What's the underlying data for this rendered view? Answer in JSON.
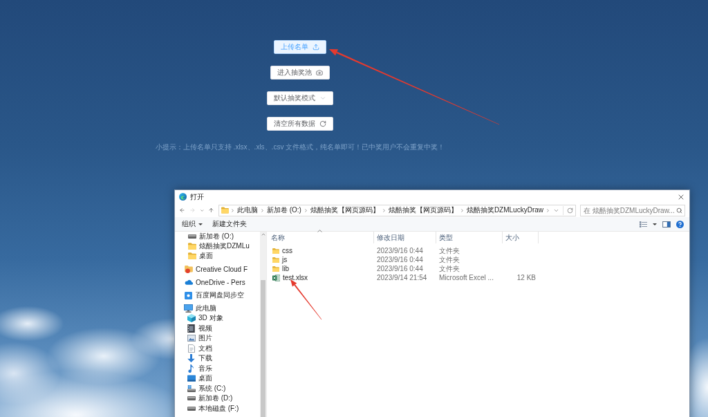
{
  "main": {
    "buttons": [
      {
        "kind": "upload",
        "label": "上传名单",
        "active": true
      },
      {
        "kind": "pool",
        "label": "进入抽奖池",
        "active": false
      },
      {
        "kind": "select",
        "label": "默认抽奖模式",
        "active": false
      },
      {
        "kind": "clear",
        "label": "清空所有数据",
        "active": false
      }
    ],
    "tip": "小提示：上传名单只支持 .xlsx、.xls、.csv 文件格式，纯名单即可！已中奖用户不会重复中奖！"
  },
  "dialog": {
    "title": "打开",
    "nav_buttons": [
      {
        "kind": "back",
        "disabled": false
      },
      {
        "kind": "forward",
        "disabled": true
      },
      {
        "kind": "recent",
        "disabled": false
      },
      {
        "kind": "up",
        "disabled": false
      }
    ],
    "breadcrumbs": [
      "此电脑",
      "新加卷 (O:)",
      "炫酷抽奖【网页源码】",
      "炫酷抽奖【网页源码】",
      "炫酷抽奖DZMLuckyDraw"
    ],
    "search": {
      "placeholder": "在 炫酷抽奖DZMLuckyDraw..."
    },
    "toolbar": [
      {
        "kind": "menu",
        "label": "组织"
      },
      {
        "kind": "plain",
        "label": "新建文件夹"
      }
    ],
    "sidebar": {
      "quick_access_items": [
        {
          "kind": "drive",
          "label": "新加卷 (O:)"
        },
        {
          "kind": "folder",
          "label": "炫酷抽奖DZMLu"
        },
        {
          "kind": "folder",
          "label": "桌面"
        }
      ],
      "items": [
        {
          "kind": "creative",
          "label": "Creative Cloud F"
        },
        {
          "kind": "cloud",
          "label": "OneDrive - Pers"
        },
        {
          "kind": "sync",
          "label": "百度网盘同步空"
        },
        {
          "kind": "computer",
          "label": "此电脑",
          "children": [
            {
              "kind": "cube",
              "label": "3D 对象"
            },
            {
              "kind": "video",
              "label": "视频"
            },
            {
              "kind": "picture",
              "label": "图片"
            },
            {
              "kind": "document",
              "label": "文档"
            },
            {
              "kind": "download",
              "label": "下载"
            },
            {
              "kind": "music",
              "label": "音乐"
            },
            {
              "kind": "desktop",
              "label": "桌面"
            },
            {
              "kind": "system",
              "label": "系统 (C:)"
            },
            {
              "kind": "drive",
              "label": "新加卷 (D:)"
            },
            {
              "kind": "drive",
              "label": "本地磁盘 (F:)"
            }
          ]
        }
      ]
    },
    "columns": [
      {
        "label": "名称",
        "sorted": true
      },
      {
        "label": "修改日期",
        "sorted": false
      },
      {
        "label": "类型",
        "sorted": false
      },
      {
        "label": "大小",
        "sorted": false
      }
    ],
    "files": [
      {
        "kind": "folder",
        "name": "css",
        "modified": "2023/9/16 0:44",
        "type": "文件夹"
      },
      {
        "kind": "folder",
        "name": "js",
        "modified": "2023/9/16 0:44",
        "type": "文件夹"
      },
      {
        "kind": "folder",
        "name": "lib",
        "modified": "2023/9/16 0:44",
        "type": "文件夹"
      },
      {
        "kind": "excel",
        "name": "test.xlsx",
        "modified": "2023/9/14 21:54",
        "type": "Microsoft Excel ...",
        "size": "12 KB"
      }
    ]
  }
}
